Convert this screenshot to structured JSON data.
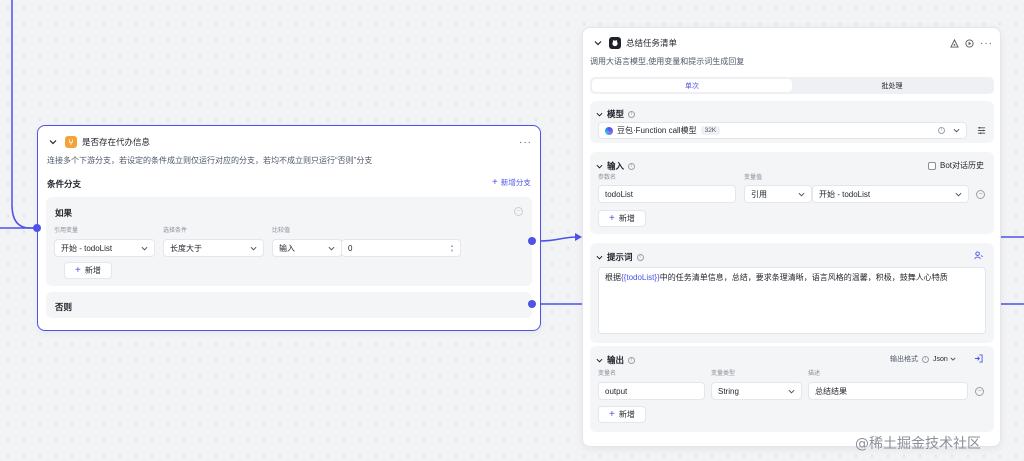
{
  "condition_node": {
    "title": "是否存在代办信息",
    "description": "连接多个下游分支，若设定的条件成立则仅运行对应的分支，若均不成立则只运行“否则”分支",
    "section_title": "条件分支",
    "add_branch_label": "新增分支",
    "if_label": "如果",
    "col_ref_var": "引用变量",
    "col_condition": "选择条件",
    "col_compare": "比较值",
    "ref_var_value": "开始 - todoList",
    "condition_value": "长度大于",
    "compare_type": "输入",
    "compare_value": "0",
    "add_label": "新增",
    "else_label": "否则"
  },
  "summary_node": {
    "title": "总结任务清单",
    "description": "调用大语言模型,使用变量和提示词生成回复",
    "tabs": [
      "单次",
      "批处理"
    ],
    "model": {
      "label": "模型",
      "value": "豆包·Function call模型",
      "badge": "32K"
    },
    "input": {
      "label": "输入",
      "bot_history_label": "Bot对话历史",
      "col_param": "参数名",
      "col_value": "变量值",
      "param_name": "todoList",
      "ref_type": "引用",
      "ref_value": "开始 - todoList",
      "add_label": "新增"
    },
    "prompt": {
      "label": "提示词",
      "text_before": "根据",
      "text_var": "{{todoList}}",
      "text_after": "中的任务清单信息，总结，要求条理清晰，语言风格的温馨，积极，鼓舞人心特质"
    },
    "output": {
      "label": "输出",
      "format_label": "输出格式",
      "format_value": "Json",
      "col_name": "变量名",
      "col_type": "变量类型",
      "col_desc": "描述",
      "var_name": "output",
      "var_type": "String",
      "var_desc": "总结结果",
      "add_label": "新增"
    }
  },
  "watermark": "@稀土掘金技术社区",
  "colors": {
    "accent": "#4d53e8",
    "condition_icon": "#f3a33a",
    "canvas": "#f2f3f5"
  }
}
